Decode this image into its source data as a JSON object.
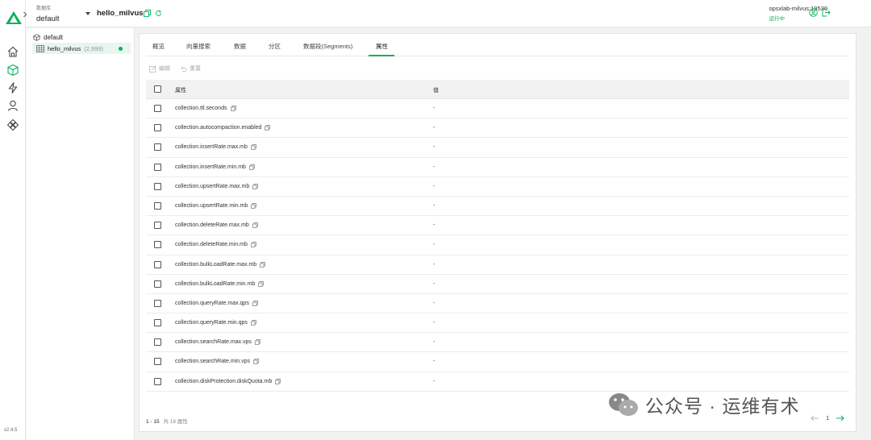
{
  "app": {
    "version": "v2.4.5"
  },
  "rail": {
    "icons": [
      "home-icon",
      "collection-cube-icon",
      "lightning-icon",
      "user-icon",
      "nodes-icon"
    ]
  },
  "topbar": {
    "db_label": "数据库",
    "db_value": "default",
    "collection_title": "hello_milvus",
    "connection_address": "opsxlab-milvus:19530",
    "connection_status": "运行中"
  },
  "tree": {
    "database": "default",
    "collection": "hello_milvus",
    "collection_count": "(2,999)"
  },
  "tabs": [
    {
      "label": "概览",
      "active": false
    },
    {
      "label": "向量搜索",
      "active": false
    },
    {
      "label": "数据",
      "active": false
    },
    {
      "label": "分区",
      "active": false
    },
    {
      "label": "数据段(Segments)",
      "active": false
    },
    {
      "label": "属性",
      "active": true
    }
  ],
  "toolbar": {
    "edit_label": "编辑",
    "reset_label": "重置"
  },
  "table": {
    "columns": {
      "property": "属性",
      "value": "值"
    },
    "rows": [
      {
        "property": "collection.ttl.seconds",
        "value": "-"
      },
      {
        "property": "collection.autocompaction.enabled",
        "value": "-"
      },
      {
        "property": "collection.insertRate.max.mb",
        "value": "-"
      },
      {
        "property": "collection.insertRate.min.mb",
        "value": "-"
      },
      {
        "property": "collection.upsertRate.max.mb",
        "value": "-"
      },
      {
        "property": "collection.upsertRate.min.mb",
        "value": "-"
      },
      {
        "property": "collection.deleteRate.max.mb",
        "value": "-"
      },
      {
        "property": "collection.deleteRate.min.mb",
        "value": "-"
      },
      {
        "property": "collection.bulkLoadRate.max.mb",
        "value": "-"
      },
      {
        "property": "collection.bulkLoadRate.min.mb",
        "value": "-"
      },
      {
        "property": "collection.queryRate.max.qps",
        "value": "-"
      },
      {
        "property": "collection.queryRate.min.qps",
        "value": "-"
      },
      {
        "property": "collection.searchRate.max.vps",
        "value": "-"
      },
      {
        "property": "collection.searchRate.min.vps",
        "value": "-"
      },
      {
        "property": "collection.diskProtection.diskQuota.mb",
        "value": "-"
      }
    ]
  },
  "footer": {
    "range": "1 - 15",
    "total": "共 18 属性"
  },
  "pager": {
    "page": "1"
  },
  "watermark": {
    "text": "公众号 · 运维有术"
  },
  "colors": {
    "accent": "#0db05c",
    "selected_bg": "#e7f6ee"
  }
}
